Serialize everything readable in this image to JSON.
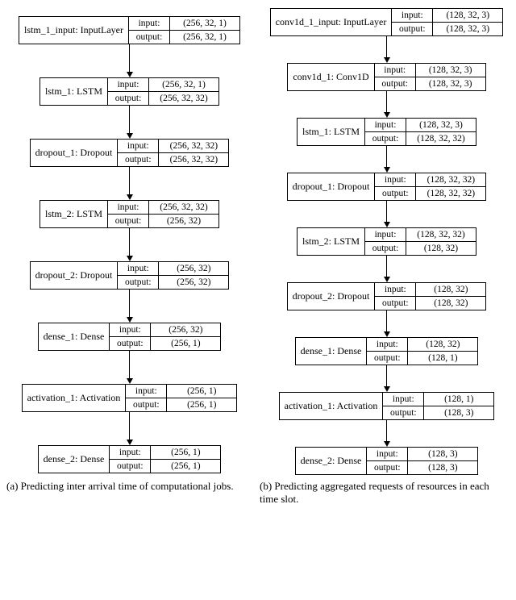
{
  "chart_data": [
    {
      "type": "diagram",
      "title": "(a) Predicting inter arrival time of computational jobs.",
      "layers": [
        {
          "name": "lstm_1_input: InputLayer",
          "input": "(256, 32, 1)",
          "output": "(256, 32, 1)"
        },
        {
          "name": "lstm_1: LSTM",
          "input": "(256, 32, 1)",
          "output": "(256, 32, 32)"
        },
        {
          "name": "dropout_1: Dropout",
          "input": "(256, 32, 32)",
          "output": "(256, 32, 32)"
        },
        {
          "name": "lstm_2: LSTM",
          "input": "(256, 32, 32)",
          "output": "(256, 32)"
        },
        {
          "name": "dropout_2: Dropout",
          "input": "(256, 32)",
          "output": "(256, 32)"
        },
        {
          "name": "dense_1: Dense",
          "input": "(256, 32)",
          "output": "(256, 1)"
        },
        {
          "name": "activation_1: Activation",
          "input": "(256, 1)",
          "output": "(256, 1)"
        },
        {
          "name": "dense_2: Dense",
          "input": "(256, 1)",
          "output": "(256, 1)"
        }
      ]
    },
    {
      "type": "diagram",
      "title": "(b) Predicting aggregated requests of resources in each time slot.",
      "layers": [
        {
          "name": "conv1d_1_input: InputLayer",
          "input": "(128, 32, 3)",
          "output": "(128, 32, 3)"
        },
        {
          "name": "conv1d_1: Conv1D",
          "input": "(128, 32, 3)",
          "output": "(128, 32, 3)"
        },
        {
          "name": "lstm_1: LSTM",
          "input": "(128, 32, 3)",
          "output": "(128, 32, 32)"
        },
        {
          "name": "dropout_1: Dropout",
          "input": "(128, 32, 32)",
          "output": "(128, 32, 32)"
        },
        {
          "name": "lstm_2: LSTM",
          "input": "(128, 32, 32)",
          "output": "(128, 32)"
        },
        {
          "name": "dropout_2: Dropout",
          "input": "(128, 32)",
          "output": "(128, 32)"
        },
        {
          "name": "dense_1: Dense",
          "input": "(128, 32)",
          "output": "(128, 1)"
        },
        {
          "name": "activation_1: Activation",
          "input": "(128, 1)",
          "output": "(128, 3)"
        },
        {
          "name": "dense_2: Dense",
          "input": "(128, 3)",
          "output": "(128, 3)"
        }
      ]
    }
  ],
  "labels": {
    "input": "input:",
    "output": "output:"
  },
  "captions": {
    "a": "(a) Predicting inter arrival time of computational jobs.",
    "b": "(b) Predicting aggregated requests of resources in each time slot."
  }
}
